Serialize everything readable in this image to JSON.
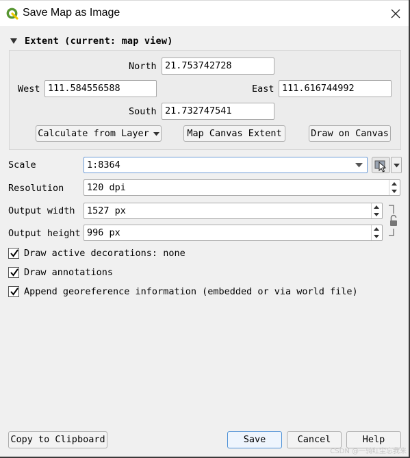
{
  "window": {
    "title": "Save Map as Image",
    "app_icon": "qgis-icon",
    "close_icon": "close-icon"
  },
  "extent": {
    "header": "Extent (current: map view)",
    "north_label": "North",
    "north_value": "21.753742728",
    "west_label": "West",
    "west_value": "111.584556588",
    "east_label": "East",
    "east_value": "111.616744992",
    "south_label": "South",
    "south_value": "21.732747541",
    "calc_button": "Calculate from Layer",
    "canvas_button": "Map Canvas Extent",
    "draw_button": "Draw on Canvas"
  },
  "form": {
    "scale_label": "Scale",
    "scale_value": "1:8364",
    "resolution_label": "Resolution",
    "resolution_value": "120 dpi",
    "width_label": "Output width",
    "width_value": "1527 px",
    "height_label": "Output height",
    "height_value": "996 px",
    "scale_tool_icon": "select-scale-icon",
    "lock_icon": "lock-ratio-icon"
  },
  "options": [
    {
      "label": "Draw active decorations: none",
      "checked": true
    },
    {
      "label": "Draw annotations",
      "checked": true
    },
    {
      "label": "Append georeference information (embedded or via world file)",
      "checked": true
    }
  ],
  "buttons": {
    "copy": "Copy to Clipboard",
    "save": "Save",
    "cancel": "Cancel",
    "help": "Help"
  },
  "watermark": "CSDN @一骑红尘忘我来",
  "colors": {
    "accent": "#4a8fd6",
    "qgis_green": "#589632",
    "qgis_yellow": "#eec900"
  }
}
